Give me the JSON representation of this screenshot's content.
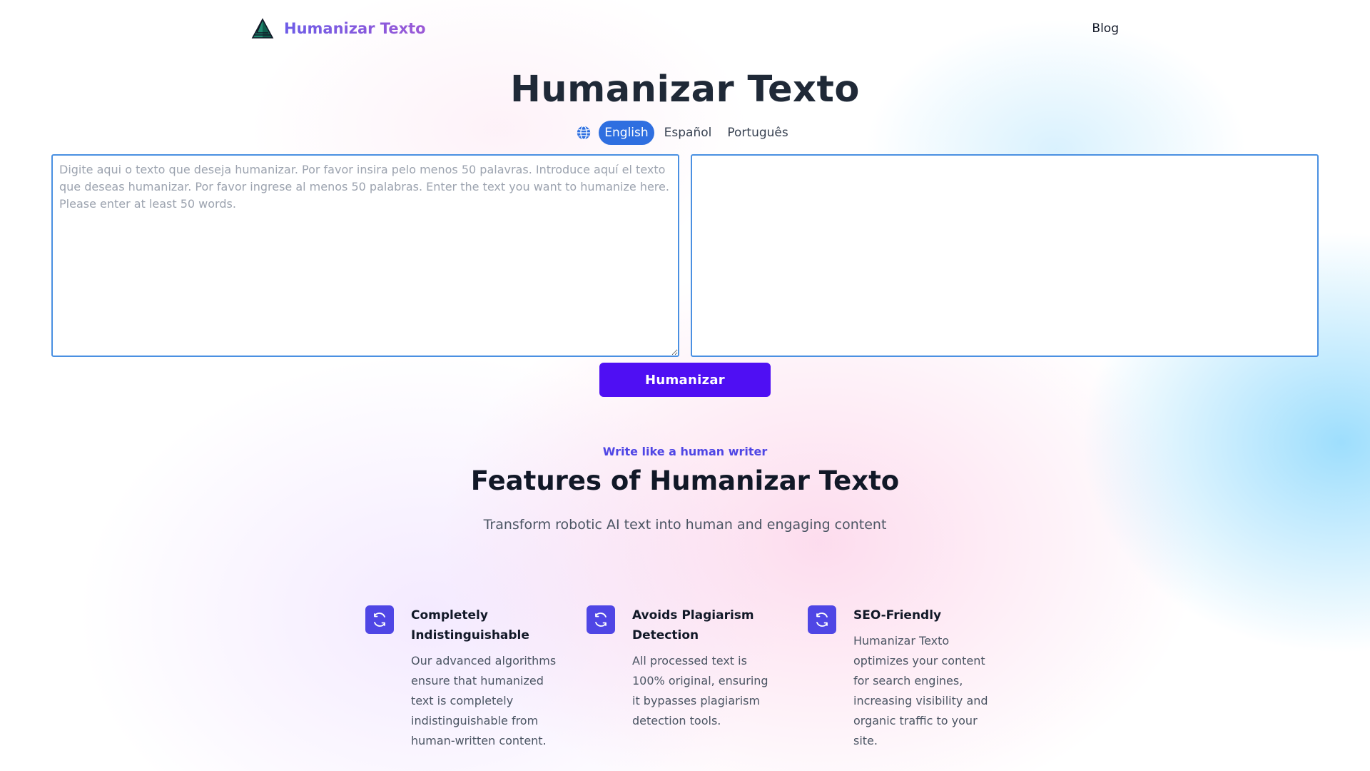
{
  "header": {
    "brand_name": "Humanizar Texto",
    "logo_icon": "pyramid-logo-icon",
    "nav_blog": "Blog"
  },
  "hero": {
    "title": "Humanizar Texto",
    "globe_icon": "globe-icon",
    "languages": [
      "English",
      "Español",
      "Português"
    ],
    "active_language": "English"
  },
  "editor": {
    "input_placeholder": "Digite aqui o texto que deseja humanizar. Por favor insira pelo menos 50 palavras. Introduce aquí el texto que deseas humanizar. Por favor ingrese al menos 50 palabras. Enter the text you want to humanize here. Please enter at least 50 words.",
    "input_value": "",
    "output_value": "",
    "submit_label": "Humanizar"
  },
  "features": {
    "eyebrow": "Write like a human writer",
    "title": "Features of Humanizar Texto",
    "subtitle": "Transform robotic AI text into human and engaging content",
    "items": [
      {
        "icon": "refresh-icon",
        "title": "Completely Indistinguishable",
        "description": "Our advanced algorithms ensure that humanized text is completely indistinguishable from human-written content."
      },
      {
        "icon": "refresh-icon",
        "title": "Avoids Plagiarism Detection",
        "description": "All processed text is 100% original, ensuring it bypasses plagiarism detection tools."
      },
      {
        "icon": "refresh-icon",
        "title": "SEO-Friendly",
        "description": "Humanizar Texto optimizes your content for search engines, increasing visibility and organic traffic to your site."
      }
    ]
  },
  "colors": {
    "brand_gradient_start": "#6d5ce7",
    "active_language_bg": "#2f6fe0",
    "submit_bg": "#4f0ff3",
    "feature_icon_bg": "#4f46e5",
    "editor_border": "#4a90e2"
  }
}
